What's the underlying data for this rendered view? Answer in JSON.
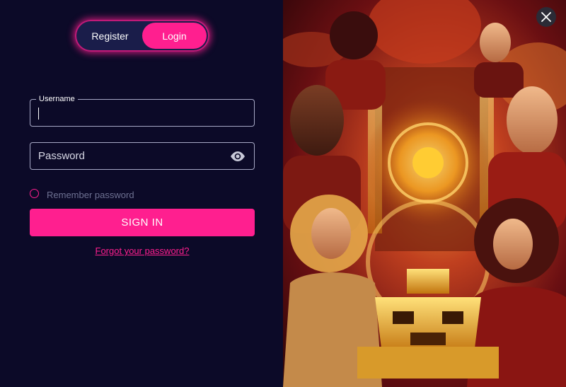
{
  "tabs": {
    "register_label": "Register",
    "login_label": "Login",
    "active": "login"
  },
  "form": {
    "username_label": "Username",
    "username_value": "",
    "password_placeholder": "Password",
    "password_value": "",
    "remember_label": "Remember password",
    "remember_checked": false,
    "signin_label": "SIGN IN",
    "forgot_label": "Forgot your password?"
  },
  "icons": {
    "password_toggle": "eye-icon",
    "close": "close-icon"
  },
  "colors": {
    "accent": "#ff1f8f",
    "background": "#0c0a28",
    "field_border": "#a7a9c6",
    "muted_text": "#6e7192"
  }
}
